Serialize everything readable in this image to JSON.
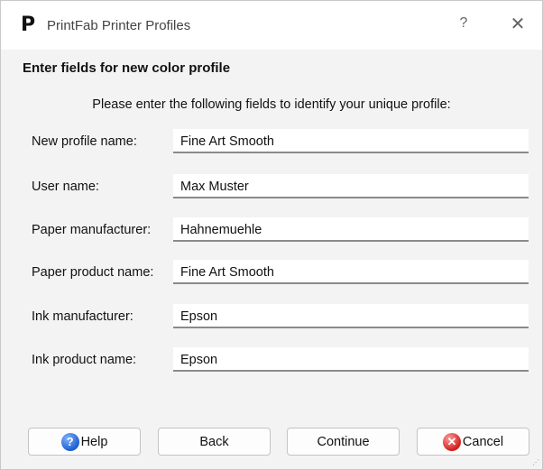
{
  "window": {
    "title": "PrintFab Printer Profiles",
    "app_icon_glyph": "P",
    "help_glyph": "?",
    "close_glyph": "✕"
  },
  "form": {
    "heading": "Enter fields for new color profile",
    "subtitle": "Please enter the following fields to identify your unique profile:",
    "fields": [
      {
        "label": "New profile name:",
        "value": "Fine Art Smooth"
      },
      {
        "label": "User name:",
        "value": "Max Muster"
      },
      {
        "label": "Paper manufacturer:",
        "value": "Hahnemuehle"
      },
      {
        "label": "Paper product name:",
        "value": "Fine Art Smooth"
      },
      {
        "label": "Ink manufacturer:",
        "value": "Epson"
      },
      {
        "label": "Ink product name:",
        "value": "Epson"
      }
    ]
  },
  "buttons": {
    "help": {
      "label": "Help",
      "icon": "help-icon",
      "icon_glyph": "?"
    },
    "back": {
      "label": "Back"
    },
    "continue": {
      "label": "Continue"
    },
    "cancel": {
      "label": "Cancel",
      "icon": "cancel-icon",
      "icon_glyph": "✕"
    }
  },
  "colors": {
    "window_bg": "#f3f3f3",
    "titlebar_bg": "#ffffff",
    "input_underline": "#8a8a8a",
    "help_icon_blue": "#1f5fd1",
    "cancel_icon_red": "#d11f1f"
  }
}
